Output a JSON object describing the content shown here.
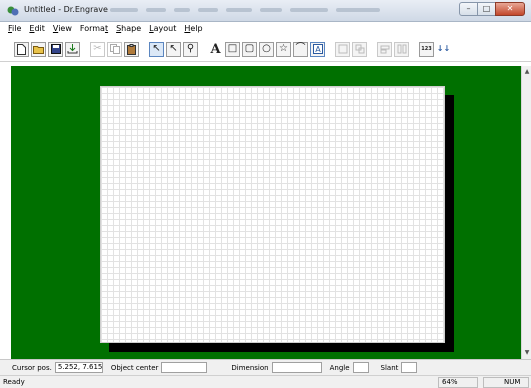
{
  "window": {
    "title": "Untitled - Dr.Engrave",
    "controls": {
      "minimize": "–",
      "maximize": "□",
      "close": "✕"
    }
  },
  "menu": [
    "File",
    "Edit",
    "View",
    "Format",
    "Shape",
    "Layout",
    "Help"
  ],
  "menu_mnemonics": [
    "F",
    "E",
    "V",
    "t",
    "S",
    "L",
    "H"
  ],
  "toolbar": {
    "icons": {
      "new": "new-document-icon",
      "open": "open-folder-icon",
      "save": "save-disk-icon",
      "import": "import-icon",
      "cut": "cut-icon",
      "copy": "copy-icon",
      "paste": "paste-icon",
      "select": "select-arrow-icon",
      "node_edit": "node-edit-icon",
      "zoom": "zoom-magnifier-icon",
      "text": "text-tool-icon",
      "rectangle": "rectangle-tool-icon",
      "rounded_rect": "rounded-rectangle-tool-icon",
      "ellipse": "ellipse-tool-icon",
      "star": "star-tool-icon",
      "line": "line-tool-icon",
      "frame_text": "frame-text-icon",
      "group": "group-icon",
      "ungroup": "ungroup-icon",
      "align": "align-icon",
      "distribute": "distribute-icon",
      "text_fit": "text-fit-icon",
      "serial": "serial-number-icon"
    },
    "glyphs": {
      "text": "A",
      "rectangle": "□",
      "rounded_rect": "▢",
      "ellipse": "○",
      "star": "☆",
      "line": "⌒",
      "select": "↖",
      "node_edit": "↖",
      "zoom": "⚲",
      "cut": "✂",
      "serial": "↓↓"
    },
    "text_fit_label": "123"
  },
  "info_bar": {
    "cursor_pos_label": "Cursor pos.",
    "cursor_pos_value": "5.252, 7.615",
    "object_center_label": "Object center",
    "object_center_value": "",
    "dimension_label": "Dimension",
    "dimension_value": "",
    "angle_label": "Angle",
    "angle_value": "",
    "slant_label": "Slant",
    "slant_value": ""
  },
  "status": {
    "text": "Ready",
    "zoom": "64%",
    "num": "NUM"
  },
  "colors": {
    "workspace": "#007000",
    "paper": "#ffffff",
    "paper_shadow": "#000000",
    "grid": "#e2e2e2"
  }
}
